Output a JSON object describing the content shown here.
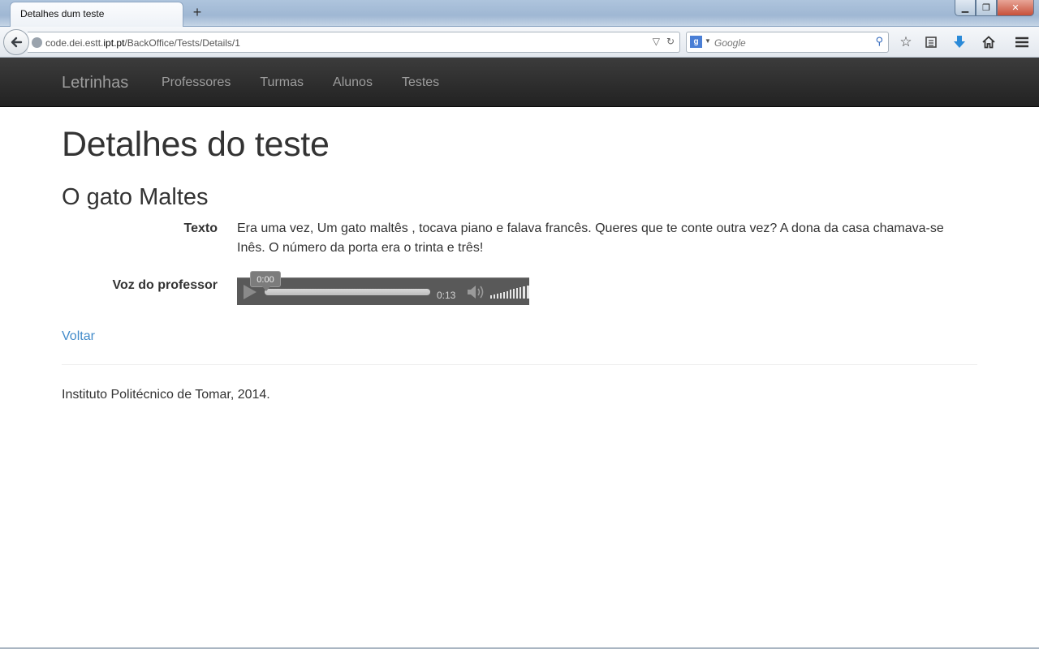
{
  "browser": {
    "tab_title": "Detalhes dum teste",
    "url_prefix": "code.dei.estt.",
    "url_host": "ipt.pt",
    "url_path": "/BackOffice/Tests/Details/1",
    "search_placeholder": "Google"
  },
  "site": {
    "brand": "Letrinhas",
    "nav": [
      "Professores",
      "Turmas",
      "Alunos",
      "Testes"
    ]
  },
  "page": {
    "title": "Detalhes do teste",
    "test_name": "O gato Maltes",
    "text_label": "Texto",
    "text_value": "Era uma vez, Um gato maltês , tocava piano e falava francês. Queres que te conte outra vez? A dona da casa chamava-se Inês. O número da porta era o trinta e três!",
    "voice_label": "Voz do professor",
    "back_link": "Voltar",
    "footer": "Instituto Politécnico de Tomar, 2014."
  },
  "audio_player": {
    "current_time": "0:00",
    "duration": "0:13",
    "progress_fraction": 0.0
  }
}
